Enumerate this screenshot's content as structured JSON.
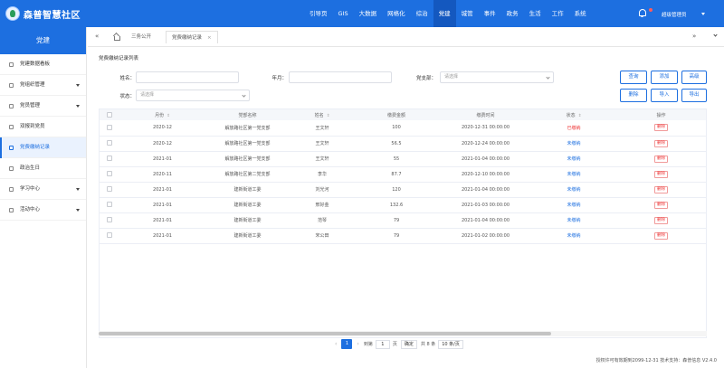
{
  "header": {
    "brand": "森普智慧社区",
    "nav": [
      "引导页",
      "GIS",
      "大数据",
      "网格化",
      "综治",
      "党建",
      "城管",
      "事件",
      "政务",
      "生活",
      "工作",
      "系统"
    ],
    "active_nav": 5,
    "user": "超级管理员"
  },
  "sidebar": {
    "title": "党建",
    "items": [
      {
        "label": "党建数据看板",
        "caret": false
      },
      {
        "label": "党组织管理",
        "caret": true
      },
      {
        "label": "党员管理",
        "caret": true
      },
      {
        "label": "双报到党员",
        "caret": false
      },
      {
        "label": "党费缴纳记录",
        "caret": false,
        "active": true
      },
      {
        "label": "政治生日",
        "caret": false
      },
      {
        "label": "学习中心",
        "caret": true
      },
      {
        "label": "活动中心",
        "caret": true
      }
    ]
  },
  "tabs": {
    "left_arrows": "«",
    "right_arrows": "»",
    "tab1": "三务公开",
    "tab2": "党费缴纳记录",
    "close": "×"
  },
  "content": {
    "title": "党费缴纳记录列表",
    "filters": {
      "name_label": "姓名：",
      "month_label": "年月：",
      "branch_label": "党支部：",
      "branch_placeholder": "请选择",
      "status_label": "状态：",
      "status_placeholder": "请选择"
    },
    "buttons": {
      "query": "查询",
      "add": "添加",
      "advanced": "高级",
      "delete": "删除",
      "import": "导入",
      "export": "导出"
    },
    "table": {
      "columns": [
        "月份",
        "党部名称",
        "姓名",
        "缴费金额",
        "缴费时间",
        "状态",
        "操作"
      ],
      "rows": [
        {
          "month": "2020-12",
          "branch": "解放路社区第一党支部",
          "name": "王文轩",
          "amount": "100",
          "time": "2020-12-31 00:00:00",
          "status": "已缴纳",
          "status_color": "red",
          "action": "删除"
        },
        {
          "month": "2020-12",
          "branch": "解放路社区第一党支部",
          "name": "王文轩",
          "amount": "56.5",
          "time": "2020-12-24 00:00:00",
          "status": "未缴纳",
          "status_color": "blue",
          "action": "删除"
        },
        {
          "month": "2021-01",
          "branch": "解放路社区第一党支部",
          "name": "王文轩",
          "amount": "55",
          "time": "2021-01-04 00:00:00",
          "status": "未缴纳",
          "status_color": "blue",
          "action": "删除"
        },
        {
          "month": "2020-11",
          "branch": "解放路社区第二党支部",
          "name": "李华",
          "amount": "87.7",
          "time": "2020-12-10 00:00:00",
          "status": "未缴纳",
          "status_color": "blue",
          "action": "删除"
        },
        {
          "month": "2021-01",
          "branch": "建新街道工委",
          "name": "刘光河",
          "amount": "120",
          "time": "2021-01-04 00:00:00",
          "status": "未缴纳",
          "status_color": "blue",
          "action": "删除"
        },
        {
          "month": "2021-01",
          "branch": "建新街道工委",
          "name": "邢好金",
          "amount": "132.6",
          "time": "2021-01-03 00:00:00",
          "status": "未缴纳",
          "status_color": "blue",
          "action": "删除"
        },
        {
          "month": "2021-01",
          "branch": "建新街道工委",
          "name": "范琴",
          "amount": "79",
          "time": "2021-01-04 00:00:00",
          "status": "未缴纳",
          "status_color": "blue",
          "action": "删除"
        },
        {
          "month": "2021-01",
          "branch": "建新街道工委",
          "name": "宋公田",
          "amount": "79",
          "time": "2021-01-02 00:00:00",
          "status": "未缴纳",
          "status_color": "blue",
          "action": "删除"
        }
      ]
    },
    "pagination": {
      "prev": "‹",
      "current": "1",
      "next": "›",
      "goto_label": "到第",
      "goto_value": "1",
      "page_unit": "页",
      "confirm": "确定",
      "total": "共 8 条",
      "page_size": "10 条/页"
    }
  },
  "footer": "授权许可有效期到2099-12-31 技术支持：森普信息 V2.4.0",
  "colors": {
    "primary": "#1d6fe0",
    "danger": "#e33333"
  }
}
